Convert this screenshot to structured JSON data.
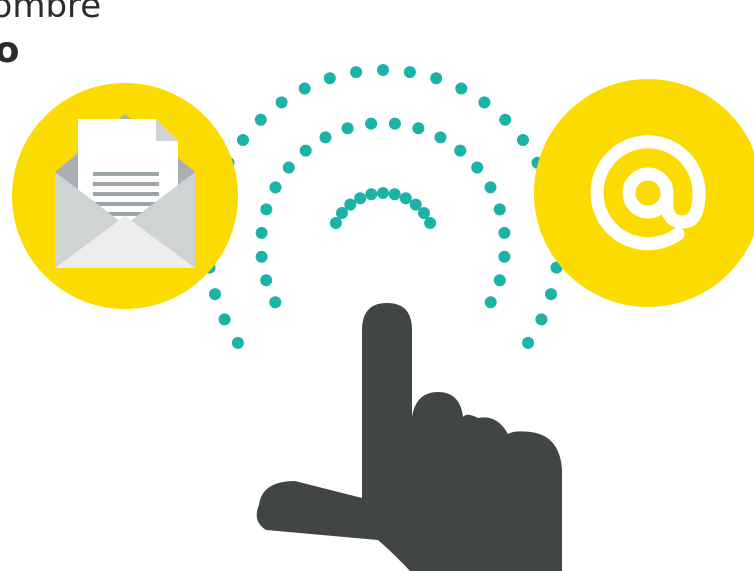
{
  "caption": {
    "line1": "nombre",
    "line2": "oo"
  },
  "colors": {
    "yellow": "#FCDB00",
    "teal": "#1BB3A8",
    "hand": "#414545",
    "envelope_light": "#EDEDED",
    "envelope_mid": "#D0D3D4",
    "envelope_dark": "#A9AFB2",
    "paper": "#FFFFFF",
    "paper_lines": "#9CA5A9",
    "at_sign": "#FFFFFF"
  },
  "icons": {
    "left": "envelope-letter-icon",
    "right": "at-sign-icon",
    "center": "pointing-hand-icon",
    "waves": "signal-wave-icon"
  }
}
